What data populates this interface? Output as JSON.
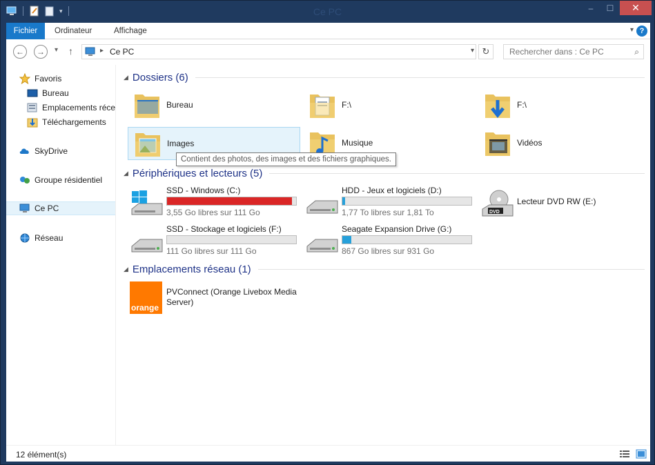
{
  "window": {
    "title": "Ce PC",
    "minimize": "–",
    "maximize": "☐",
    "close": "✕"
  },
  "ribbon": {
    "tabs": [
      "Fichier",
      "Ordinateur",
      "Affichage"
    ],
    "expand_icon": "chevron-down-icon",
    "help": "?"
  },
  "nav": {
    "back": "←",
    "forward": "→",
    "recent": "▾",
    "up": "↑",
    "address": "Ce PC",
    "refresh": "↻",
    "search_placeholder": "Rechercher dans : Ce PC"
  },
  "sidebar": {
    "items": [
      {
        "label": "Favoris",
        "icon": "star-icon"
      },
      {
        "label": "Bureau",
        "icon": "desktop-icon"
      },
      {
        "label": "Emplacements récents",
        "icon": "recent-places-icon"
      },
      {
        "label": "Téléchargements",
        "icon": "downloads-icon"
      },
      {
        "label": "SkyDrive",
        "icon": "cloud-icon"
      },
      {
        "label": "Groupe résidentiel",
        "icon": "homegroup-icon"
      },
      {
        "label": "Ce PC",
        "icon": "computer-icon"
      },
      {
        "label": "Réseau",
        "icon": "network-icon"
      }
    ]
  },
  "groups": {
    "folders": {
      "title": "Dossiers (6)",
      "items": [
        {
          "label": "Bureau",
          "icon": "desktop-folder-icon"
        },
        {
          "label": "F:\\",
          "icon": "documents-folder-icon"
        },
        {
          "label": "F:\\",
          "icon": "downloads-folder-icon"
        },
        {
          "label": "Images",
          "icon": "pictures-folder-icon"
        },
        {
          "label": "Musique",
          "icon": "music-folder-icon"
        },
        {
          "label": "Vidéos",
          "icon": "videos-folder-icon"
        }
      ],
      "tooltip": "Contient des photos, des images et des fichiers graphiques."
    },
    "drives": {
      "title": "Périphériques et lecteurs (5)",
      "items": [
        {
          "name": "SSD - Windows (C:)",
          "free": "3,55 Go libres sur 111 Go",
          "used_fraction": 0.968,
          "icon": "windows-drive-icon"
        },
        {
          "name": "HDD - Jeux et logiciels (D:)",
          "free": "1,77 To libres sur 1,81 To",
          "used_fraction": 0.022,
          "icon": "hard-drive-icon"
        },
        {
          "name": "Lecteur DVD RW (E:)",
          "icon": "dvd-drive-icon"
        },
        {
          "name": "SSD - Stockage et logiciels (F:)",
          "free": "111 Go libres sur 111 Go",
          "used_fraction": 0.0,
          "icon": "hard-drive-icon"
        },
        {
          "name": "Seagate Expansion Drive (G:)",
          "free": "867 Go libres sur 931 Go",
          "used_fraction": 0.069,
          "icon": "hard-drive-icon"
        }
      ]
    },
    "network": {
      "title": "Emplacements réseau (1)",
      "items": [
        {
          "label": "PVConnect (Orange Livebox Media Server)",
          "logo_text": "orange",
          "icon": "orange-logo-icon"
        }
      ]
    }
  },
  "status": {
    "count": "12 élément(s)"
  },
  "colors": {
    "titlebar": "#1f3a5f",
    "accent": "#1979ca",
    "group_title": "#1e3287",
    "bar_normal": "#26a0da",
    "bar_full": "#da2626",
    "orange_brand": "#ff7900"
  }
}
